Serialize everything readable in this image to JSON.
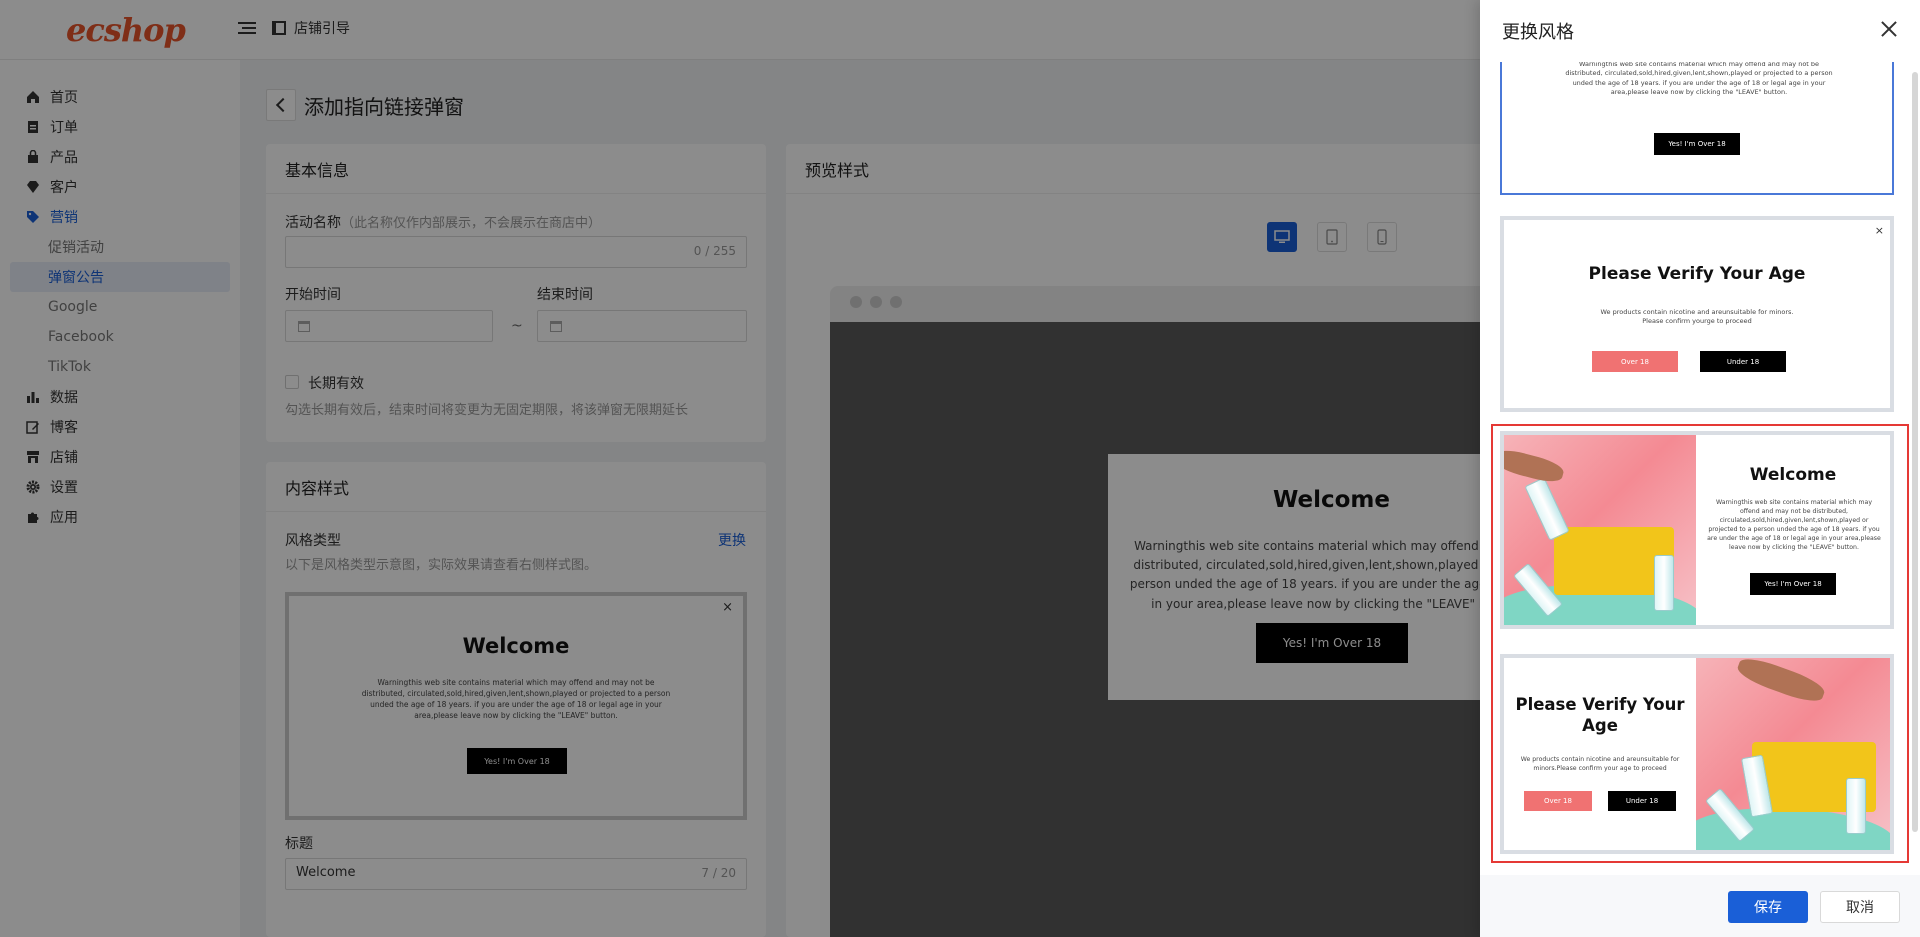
{
  "header": {
    "logo_text": "ecshop",
    "guide_label": "店铺引导"
  },
  "sidebar": {
    "items": [
      {
        "label": "首页",
        "icon": "home-icon"
      },
      {
        "label": "订单",
        "icon": "clipboard-icon"
      },
      {
        "label": "产品",
        "icon": "bag-icon"
      },
      {
        "label": "客户",
        "icon": "diamond-icon"
      },
      {
        "label": "营销",
        "icon": "tag-icon",
        "active": true
      },
      {
        "label": "数据",
        "icon": "bar-chart-icon"
      },
      {
        "label": "博客",
        "icon": "edit-icon"
      },
      {
        "label": "店铺",
        "icon": "store-icon"
      },
      {
        "label": "设置",
        "icon": "gear-icon"
      },
      {
        "label": "应用",
        "icon": "puzzle-icon"
      }
    ],
    "marketing_sub": [
      {
        "label": "促销活动"
      },
      {
        "label": "弹窗公告",
        "active": true
      },
      {
        "label": "Google"
      },
      {
        "label": "Facebook"
      },
      {
        "label": "TikTok"
      }
    ]
  },
  "page": {
    "title": "添加指向链接弹窗"
  },
  "basic_info": {
    "heading": "基本信息",
    "name_label": "活动名称",
    "name_hint": "（此名称仅作内部展示，不会展示在商店中）",
    "name_counter": "0 / 255",
    "start_label": "开始时间",
    "end_label": "结束时间",
    "range_sep": "~",
    "long_term_label": "长期有效",
    "long_term_help": "勾选长期有效后，结束时间将变更为无固定期限，将该弹窗无限期延长"
  },
  "content_style": {
    "heading": "内容样式",
    "style_type_label": "风格类型",
    "change_link": "更换",
    "style_desc": "以下是风格类型示意图，实际效果请查看右侧样式图。",
    "title_label": "标题",
    "title_value": "Welcome",
    "title_counter": "7 / 20"
  },
  "popup_welcome": {
    "title": "Welcome",
    "body": "Warningthis web site contains material which may offend and may not be distributed, circulated,sold,hired,given,lent,shown,played or projected to a person unded the age of 18 years. if you are under the age of 18 or legal age in your area,please leave now by clicking the \"LEAVE\" button.",
    "button": "Yes! I'm Over 18",
    "close": "×"
  },
  "popup_verify": {
    "title": "Please Verify Your Age",
    "body": "We products contain nicotine and areunsuitable for minors. Please confirm yourge to proceed",
    "body_split": "We products contain nicotine and areunsuitable for minors.Please confirm your age to proceed",
    "over_btn": "Over 18",
    "under_btn": "Under 18"
  },
  "preview": {
    "heading": "预览样式",
    "preview_body": "Warningthis web site contains material which may offend and ma distributed, circulated,sold,hired,given,lent,shown,played or proje person unded the age of 18 years. if you are under the age of 18 o in your area,please leave now by clicking the \"LEAVE\" butto"
  },
  "drawer": {
    "title": "更换风格",
    "save": "保存",
    "cancel": "取消"
  },
  "colors": {
    "primary": "#1a5fd7",
    "danger": "#e53935",
    "over_btn": "#f07272"
  }
}
